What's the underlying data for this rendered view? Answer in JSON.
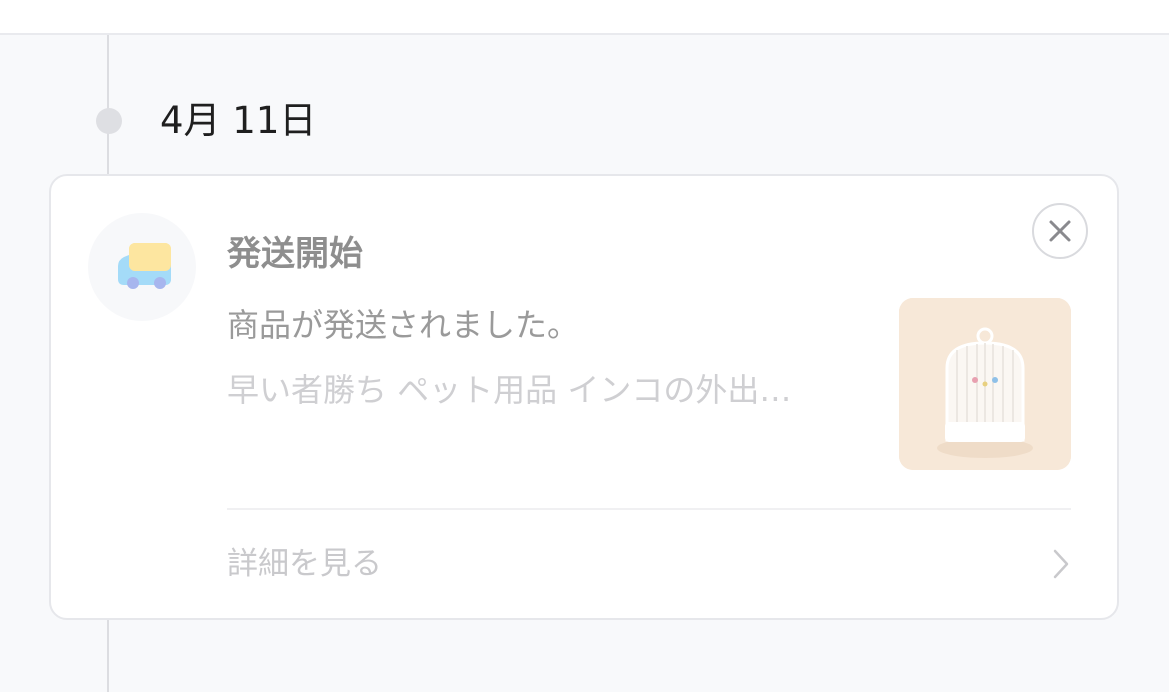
{
  "timeline": {
    "date": "4月 11日"
  },
  "notification": {
    "title": "発送開始",
    "message": "商品が発送されました。",
    "product_name": "早い者勝ち ペット用品 インコの外出…",
    "detail_label": "詳細を見る",
    "icon": "delivery-truck-icon",
    "thumbnail_subject": "birdcage",
    "close_icon": "close-icon",
    "chevron_icon": "chevron-right-icon"
  },
  "colors": {
    "background": "#f8f9fb",
    "card": "#ffffff",
    "truck_cargo": "#fde6a0",
    "truck_cab": "#a4dbf8",
    "truck_wheels": "#a7b6ee",
    "title_text": "#8e8e8e",
    "muted_text": "#cfcfd2"
  }
}
